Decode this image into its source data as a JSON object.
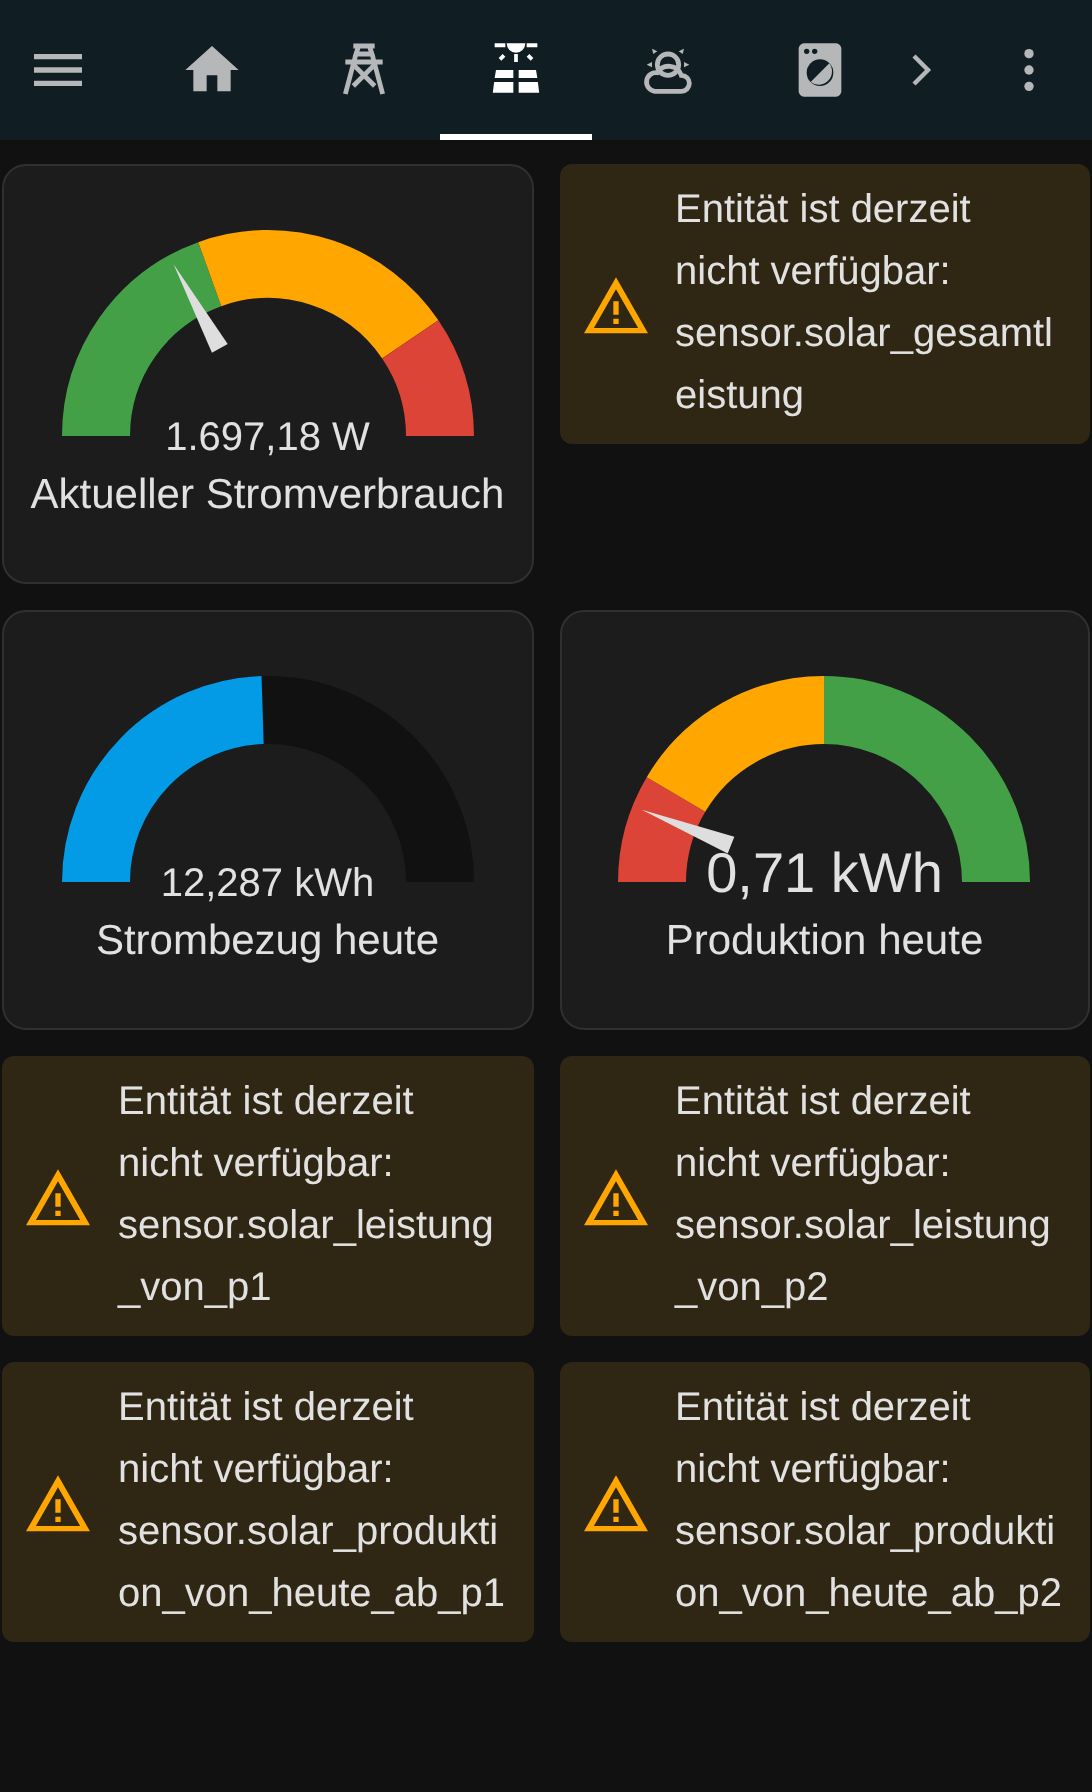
{
  "toolbar": {
    "tabs": [
      {
        "kind": "home",
        "selected": false
      },
      {
        "kind": "tower",
        "selected": false
      },
      {
        "kind": "solar",
        "selected": true
      },
      {
        "kind": "weather",
        "selected": false
      },
      {
        "kind": "washer",
        "selected": false
      }
    ]
  },
  "cards": [
    {
      "kind": "severity_gauge",
      "value": "1.697,18 W",
      "name": "Aktueller Stromverbrauch",
      "segments": [
        {
          "color": "#43a047"
        },
        {
          "color": "#ffa600"
        },
        {
          "color": "#db4437"
        }
      ]
    },
    {
      "kind": "warning",
      "text": "Entität ist derzeit nicht verfügbar: sensor.solar_gesamtleistung"
    },
    {
      "kind": "fill_gauge",
      "value": "12,287 kWh",
      "name": "Strombezug heute",
      "color": "#039be5"
    },
    {
      "kind": "severity_gauge",
      "value": "0,71 kWh",
      "name": "Produktion heute",
      "segments": [
        {
          "color": "#db4437"
        },
        {
          "color": "#ffa600"
        },
        {
          "color": "#43a047"
        }
      ]
    },
    {
      "kind": "warning",
      "text": "Entität ist derzeit nicht verfügbar: sensor.solar_leistung_von_p1"
    },
    {
      "kind": "warning",
      "text": "Entität ist derzeit nicht verfügbar: sensor.solar_leistung_von_p2"
    },
    {
      "kind": "warning",
      "text": "Entität ist derzeit nicht verfügbar: sensor.solar_produktion_von_heute_ab_p1"
    },
    {
      "kind": "warning",
      "text": "Entität ist derzeit nicht verfügbar: sensor.solar_produktion_von_heute_ab_p2"
    }
  ]
}
